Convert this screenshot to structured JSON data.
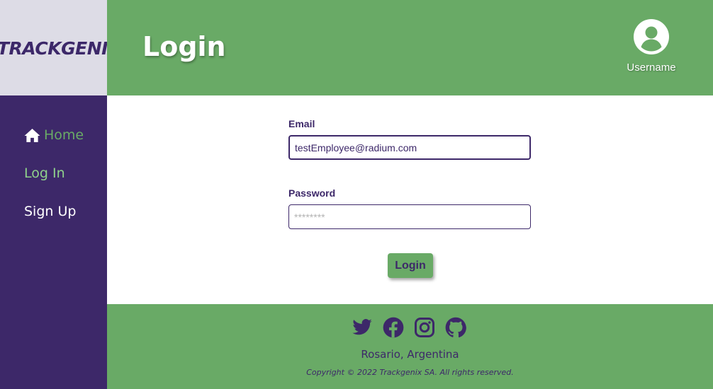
{
  "brand": {
    "logo_text": "TRACKGENIX"
  },
  "header": {
    "title": "Login",
    "username": "Username",
    "avatar_icon": "user-circle-icon"
  },
  "sidebar": {
    "items": [
      {
        "label": "Home",
        "icon": "home-icon"
      },
      {
        "label": "Log In"
      },
      {
        "label": "Sign Up"
      }
    ]
  },
  "form": {
    "email_label": "Email",
    "email_value": "testEmployee@radium.com",
    "password_label": "Password",
    "password_placeholder": "********",
    "submit_label": "Login"
  },
  "footer": {
    "social": [
      "twitter-icon",
      "facebook-icon",
      "instagram-icon",
      "github-icon"
    ],
    "location": "Rosario, Argentina",
    "copyright": "Copyright © 2022 Trackgenix SA. All rights reserved."
  },
  "colors": {
    "primary_green": "#69aa66",
    "primary_purple": "#3d2869",
    "logo_bg": "#dddce6",
    "active_nav": "#8fd18b"
  }
}
